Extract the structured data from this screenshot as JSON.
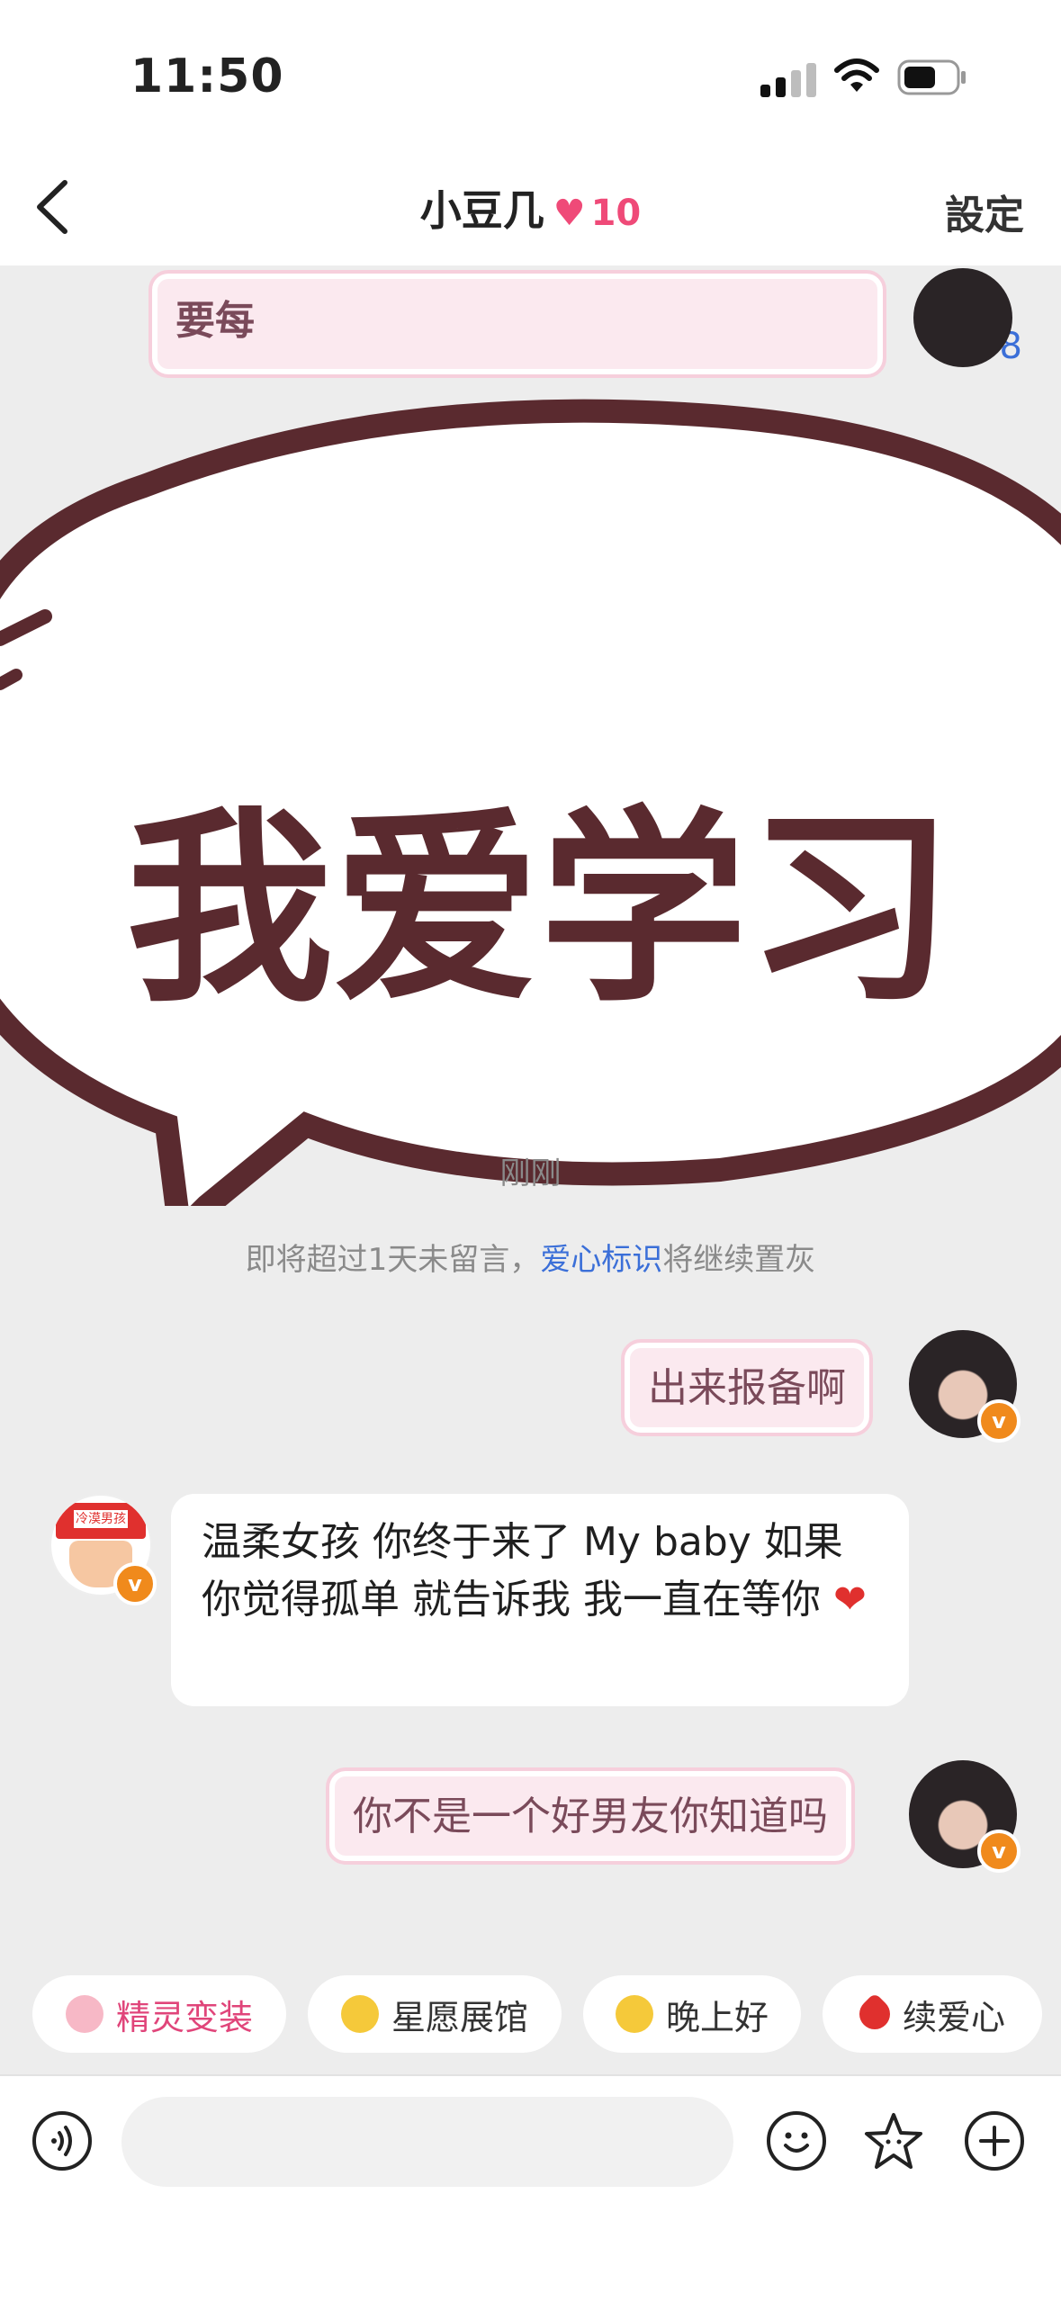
{
  "status_bar": {
    "time": "11:50"
  },
  "nav": {
    "title": "小豆几",
    "heart": "♥",
    "heart_count": "10",
    "settings": "設定"
  },
  "sticker": {
    "text": "我爱学习",
    "partial_text": "要每",
    "partial_number": "58"
  },
  "messages": {
    "timestamp": "刚刚",
    "notice_prefix": "即将超过1天未留言，",
    "notice_link": "爱心标识",
    "notice_suffix": "将继续置灰",
    "m1": "出来报备啊",
    "m2": "温柔女孩 你终于来了  My baby 如果你觉得孤单 就告诉我  我一直在等你",
    "m2_heart": "❤",
    "m3": "你不是一个好男友你知道吗",
    "badge": "v",
    "contact_avatar_label": "冷漠男孩"
  },
  "chips": [
    {
      "label": "精灵变装",
      "color": "#e0457a"
    },
    {
      "label": "星愿展馆",
      "color": "#333333"
    },
    {
      "label": "晚上好",
      "color": "#333333"
    },
    {
      "label": "续爱心",
      "color": "#333333"
    }
  ],
  "colors": {
    "accent_pink": "#ef4a78",
    "link_blue": "#3b6fd8",
    "sticker_brown": "#5a2a2f"
  },
  "input": {
    "placeholder": ""
  }
}
